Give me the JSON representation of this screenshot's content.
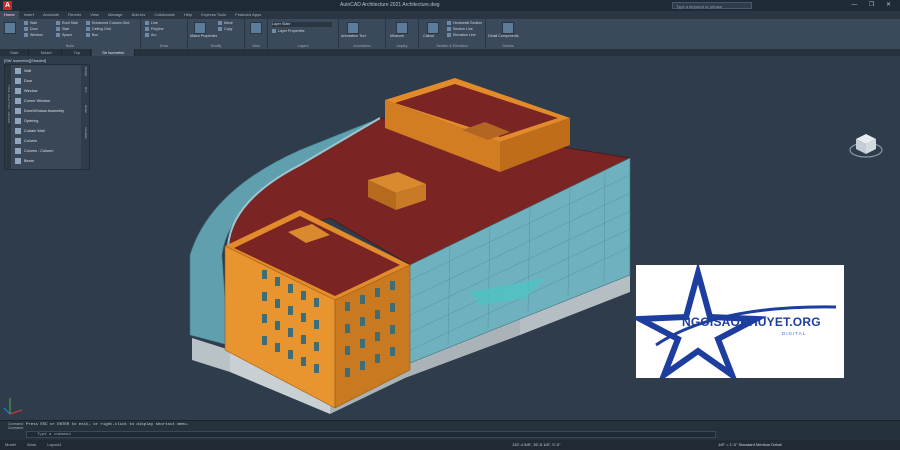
{
  "title_bar": {
    "title": "AutoCAD Architecture 2021   Architecture.dwg",
    "search_placeholder": "Type a keyword or phrase",
    "window_buttons": "— ❐ ✕"
  },
  "ribbon_tabs": [
    "Home",
    "Insert",
    "Annotate",
    "Render",
    "View",
    "Manage",
    "Add-ins",
    "Collaborate",
    "Help",
    "Express Tools",
    "Featured Apps"
  ],
  "ribbon": {
    "panels": [
      {
        "name": "Build",
        "tools": [
          "Wall",
          "Door",
          "Window",
          "Roof Slab",
          "Stair",
          "Space",
          "Enhanced Custom Grid",
          "Ceiling Grid",
          "Box"
        ]
      },
      {
        "name": "Draw",
        "tools": [
          "Line",
          "Polyline",
          "Arc"
        ]
      },
      {
        "name": "Modify",
        "tools": [
          "Match Properties",
          "Move",
          "Copy"
        ]
      },
      {
        "name": "View",
        "tools": [
          "Visual Styles"
        ]
      },
      {
        "name": "Layers",
        "tools": [
          "Layer Properties",
          "Layer State"
        ]
      },
      {
        "name": "Annotation",
        "tools": [
          "Annotation Text"
        ]
      },
      {
        "name": "Inquiry",
        "tools": [
          "Measure"
        ]
      },
      {
        "name": "Section & Elevation",
        "tools": [
          "Horizontal Section",
          "Section Line",
          "Elevation Line",
          "Callout"
        ]
      },
      {
        "name": "Details",
        "tools": [
          "Detail Components"
        ]
      }
    ]
  },
  "doc_tabs": [
    "Start",
    "Model",
    "Top",
    "Se Isometric"
  ],
  "viewport": {
    "label": "[SW Isometric][Shaded]"
  },
  "palette": {
    "side_title": "TOOL PALETTES - DESIGN",
    "tabs": [
      "Design",
      "Doc",
      "Detail",
      "Visualize"
    ],
    "tools": [
      "Wall",
      "Door",
      "Window",
      "Corner Window",
      "Door/Window Assembly",
      "Opening",
      "Curtain Wall",
      "Column",
      "Column : Column",
      "Beam"
    ]
  },
  "command": {
    "labels": [
      "Command:",
      "Command:"
    ],
    "history": "Press ESC or ENTER to exit, or right-click to display shortcut menu.",
    "input_placeholder": "Type a command"
  },
  "status": {
    "layout_tabs": [
      "Model",
      "Work",
      "Layout1"
    ],
    "coords": "132'-4 5/8\", 35'-5 1/8\", 0'-0\"",
    "scale": "1/8\" = 1'-0\"  Standard  Medium Detail"
  },
  "logo": {
    "text": "NGOISAOKHUYET.ORG",
    "sub": "DIGITAL"
  }
}
